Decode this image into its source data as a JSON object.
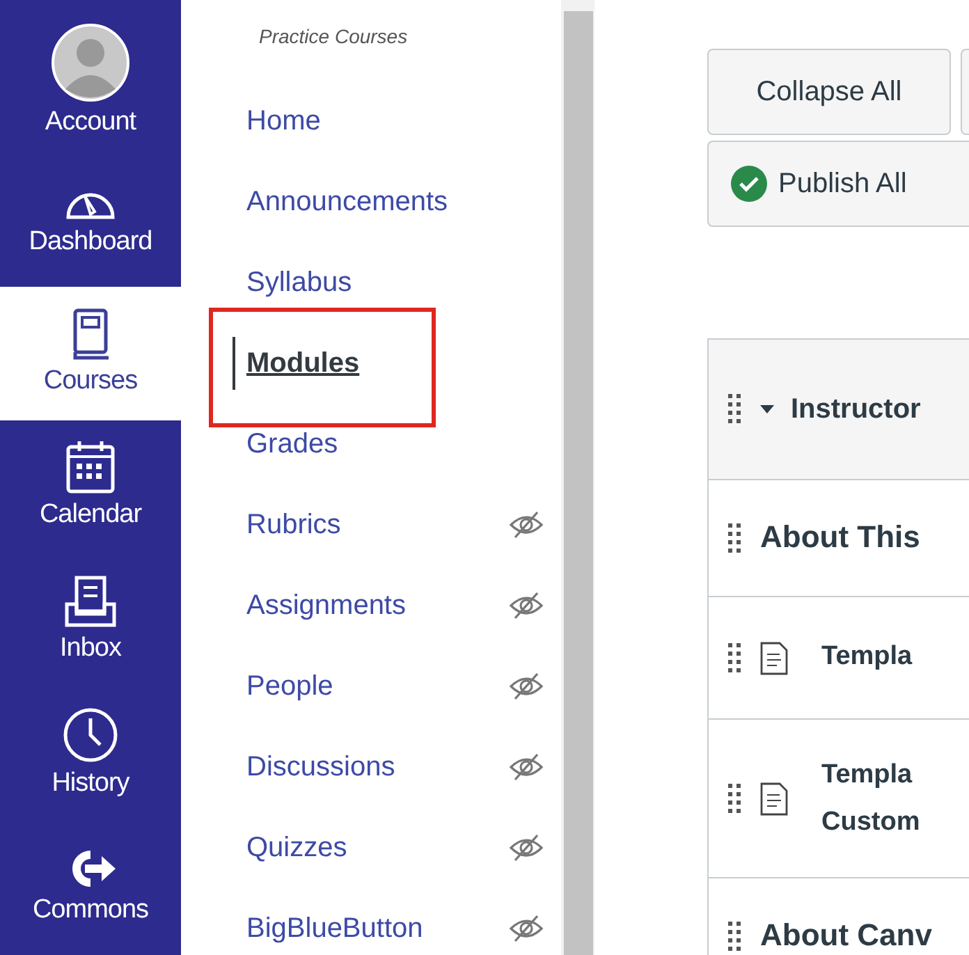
{
  "global_nav": [
    {
      "label": "Account",
      "selected": false
    },
    {
      "label": "Dashboard",
      "selected": false
    },
    {
      "label": "Courses",
      "selected": true
    },
    {
      "label": "Calendar",
      "selected": false
    },
    {
      "label": "Inbox",
      "selected": false
    },
    {
      "label": "History",
      "selected": false
    },
    {
      "label": "Commons",
      "selected": false
    }
  ],
  "course_nav": {
    "title": "Practice Courses",
    "items": [
      {
        "label": "Home",
        "selected": false,
        "hidden": false,
        "annotated": false
      },
      {
        "label": "Announcements",
        "selected": false,
        "hidden": false,
        "annotated": false
      },
      {
        "label": "Syllabus",
        "selected": false,
        "hidden": false,
        "annotated": false
      },
      {
        "label": "Modules",
        "selected": true,
        "hidden": false,
        "annotated": true
      },
      {
        "label": "Grades",
        "selected": false,
        "hidden": false,
        "annotated": false
      },
      {
        "label": "Rubrics",
        "selected": false,
        "hidden": true,
        "annotated": false
      },
      {
        "label": "Assignments",
        "selected": false,
        "hidden": true,
        "annotated": false
      },
      {
        "label": "People",
        "selected": false,
        "hidden": true,
        "annotated": false
      },
      {
        "label": "Discussions",
        "selected": false,
        "hidden": true,
        "annotated": false
      },
      {
        "label": "Quizzes",
        "selected": false,
        "hidden": true,
        "annotated": false
      },
      {
        "label": "BigBlueButton",
        "selected": false,
        "hidden": true,
        "annotated": false
      }
    ]
  },
  "toolbar": {
    "collapse_button": "Collapse All",
    "publish_button": "Publish All"
  },
  "module_rows": [
    {
      "kind": "header",
      "lines": [
        "Instructor"
      ]
    },
    {
      "kind": "subheader",
      "lines": [
        "About This"
      ]
    },
    {
      "kind": "page",
      "lines": [
        "Templa"
      ]
    },
    {
      "kind": "page",
      "lines": [
        "Templa",
        "Custom"
      ]
    },
    {
      "kind": "subheader",
      "lines": [
        "About Canv"
      ]
    }
  ]
}
